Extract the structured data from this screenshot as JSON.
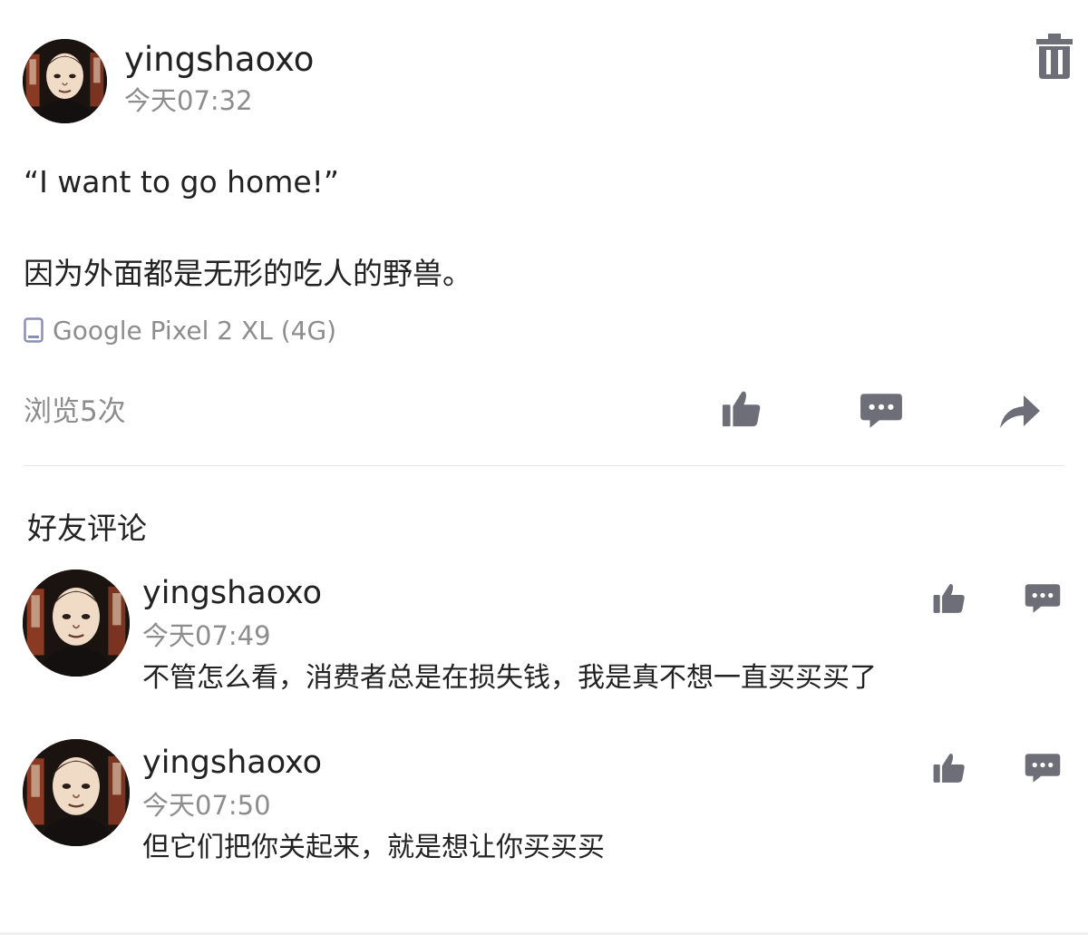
{
  "post": {
    "username": "yingshaoxo",
    "time": "今天07:32",
    "quote": "“I want to go home!”",
    "body": "因为外面都是无形的吃人的野兽。",
    "device": "Google Pixel 2 XL (4G)",
    "views": "浏览5次"
  },
  "comments_section": {
    "title": "好友评论",
    "items": [
      {
        "username": "yingshaoxo",
        "time": "今天07:49",
        "text": "不管怎么看，消费者总是在损失钱，我是真不想一直买买买了"
      },
      {
        "username": "yingshaoxo",
        "time": "今天07:50",
        "text": "但它们把你关起来，就是想让你买买买"
      }
    ]
  },
  "icons": {
    "delete": "trash-icon",
    "like": "thumbs-up-icon",
    "comment": "comment-bubble-icon",
    "share": "share-arrow-icon",
    "device": "phone-icon"
  },
  "colors": {
    "icon_gray": "#6e6e78",
    "secondary_text": "#8d8d8d",
    "primary_text": "#222222",
    "divider": "#e6e6e6",
    "device_icon": "#8a8fb5"
  }
}
